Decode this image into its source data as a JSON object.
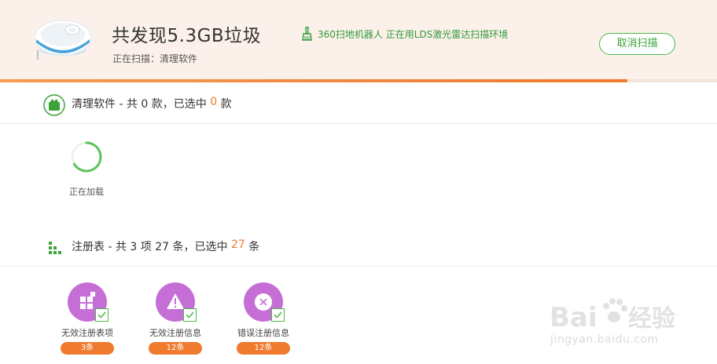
{
  "header": {
    "title": "共发现5.3GB垃圾",
    "scan_label": "正在扫描：",
    "scan_value": "清理软件",
    "lds_note": "360扫地机器人 正在用LDS激光雷达扫描环境",
    "cancel_label": "取消扫描",
    "progress_fraction": 0.875
  },
  "software_section": {
    "title_prefix": "清理软件 - 共 0 款，已选中 ",
    "selected": "0",
    "title_suffix": " 款",
    "loading_text": "正在加载"
  },
  "registry_section": {
    "title_prefix": "注册表 - 共 3 项 27 条，已选中 ",
    "selected": "27",
    "title_suffix": " 条",
    "items": [
      {
        "name": "无效注册表项",
        "count": "3条",
        "icon": "windows-grid-icon"
      },
      {
        "name": "无效注册信息",
        "count": "12条",
        "icon": "warning-icon"
      },
      {
        "name": "错误注册信息",
        "count": "12条",
        "icon": "error-x-icon"
      }
    ]
  },
  "watermark": {
    "brand": "Baidu经验",
    "url": "jingyan.baidu.com"
  },
  "colors": {
    "accent_orange": "#f07a2e",
    "accent_green": "#4cb84c",
    "card_purple": "#c56fd6",
    "header_bg": "#fcf1ea"
  }
}
